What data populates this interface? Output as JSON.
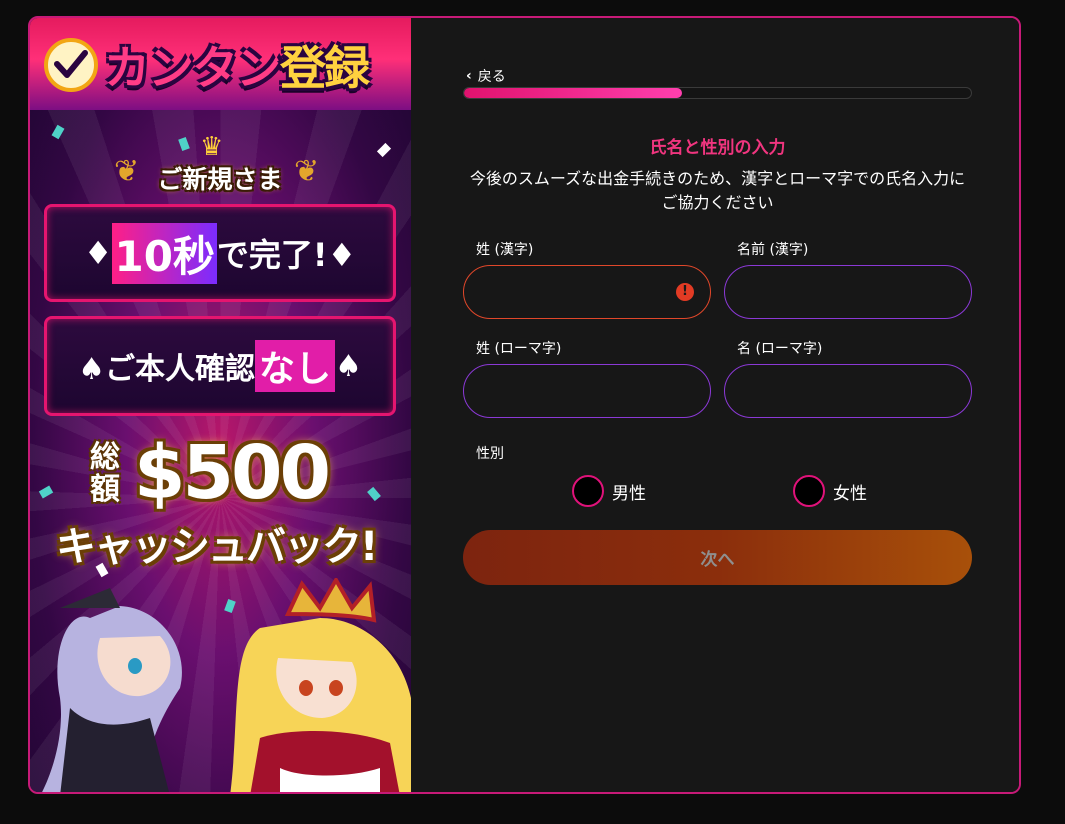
{
  "promo": {
    "title_part1": "カンタン",
    "title_part2": "登録",
    "welcome": "ご新規さま",
    "box1_pre": "♦",
    "box1_highlight": "10秒",
    "box1_post": "で完了!♦",
    "box2_pre": "♠ご本人確認",
    "box2_highlight": "なし",
    "box2_post": "♠",
    "total_label": "総額",
    "amount": "$500",
    "cashback": "キャッシュバック!"
  },
  "form": {
    "back_label": "戻る",
    "progress": 0.43,
    "title": "氏名と性別の入力",
    "description": "今後のスムーズな出金手続きのため、漢字とローマ字での氏名入力にご協力ください",
    "last_name_kanji_label": "姓 (漢字)",
    "first_name_kanji_label": "名前 (漢字)",
    "last_name_roman_label": "姓 (ローマ字)",
    "first_name_roman_label": "名 (ローマ字)",
    "last_name_kanji_value": "",
    "first_name_kanji_value": "",
    "last_name_roman_value": "",
    "first_name_roman_value": "",
    "error_icon": "!",
    "gender_label": "性別",
    "gender_male": "男性",
    "gender_female": "女性",
    "next_label": "次へ"
  },
  "colors": {
    "accent": "#e0127a",
    "title": "#f0357f",
    "input_border": "#8b39d6",
    "error": "#e0472a"
  }
}
